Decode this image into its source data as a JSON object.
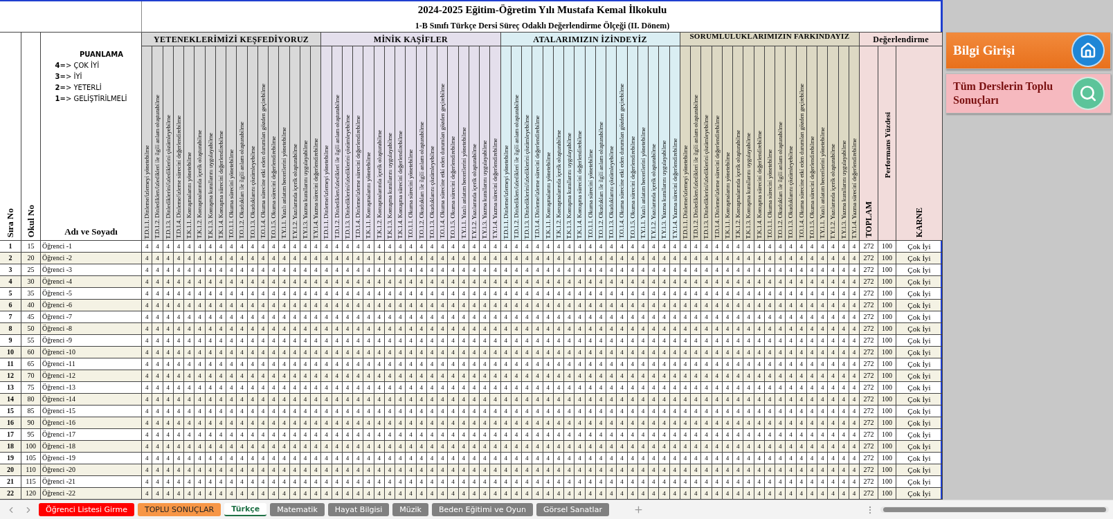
{
  "title": "2024-2025 Eğitim-Öğretim Yılı Mustafa Kemal İlkokulu",
  "subtitle": "1-B Sınıfı Türkçe Dersi Süreç Odaklı Değerlendirme Ölçeği (II. Dönem)",
  "left_headers": {
    "sira": "Sıra No",
    "okul": "Okul No",
    "name": "Adı ve Soyadı"
  },
  "legend": {
    "title": "PUANLAMA",
    "lines": [
      "**4**=> ÇOK İYİ",
      "**3**=> İYİ",
      "**2**=> YETERLİ",
      "**1**=> GELİŞTİRİLMELİ"
    ]
  },
  "sections": [
    {
      "title": "YETENEKLERİMİZİ KEŞFEDİYORUZ",
      "color": "#d9d9d9",
      "criteria": [
        "T.D.1.1. Dinleme/izlemeyi yönetebilme",
        "T.D.1.2. Dinlediklerı/izledikleri ile ilgili anlam oluşturabilme",
        "T.D.1.3. Dinlediklerini/izlediklerini çözümleyebilme",
        "T.D.1.4. Dinleme/izleme sürecini değerlendirebilme",
        "T.K.1.1. Konuşmalarını yönetebilme",
        "T.K.1.2. Konuşmalarında içerik oluşturabilme",
        "T.K.1.3. Konuşma kurallarını uygulayabilme",
        "T.K.1.4. Konuşma sürecini değerlendirebilme",
        "T.O.1.1. Okuma sürecini yönetebilme",
        "T.O.1.2. Okudukları ile ilgili anlam oluşturabilme",
        "T.O.1.3. Okuduklarını çözümleyebilme",
        "T.O.1.4. Okuma sürecine etki eden durumları gözden geçirebilme",
        "T.O.1.5. Okuma sürecini değerlendirebilme",
        "T.Y.1.1. Yazılı anlatım becerilerini yönetebilme",
        "T.Y.1.2. Yazılarında içerik oluşturabilme",
        "T.Y.1.3. Yazma kurallarını uygulayabilme",
        "T.Y.1.4. Yazma sürecini değerlendirebilme"
      ]
    },
    {
      "title": "MİNİK KAŞİFLER",
      "color": "#e4dfec",
      "criteria": [
        "T.D.1.1. Dinleme/izlemeyi yönetebilme",
        "T.D.1.2. Dinlediklerı/izledikleri ile ilgili anlam oluşturabilme",
        "T.D.1.3. Dinlediklerini/izlediklerini çözümleyebilme",
        "T.D.1.4. Dinleme/izleme sürecini değerlendirebilme",
        "T.K.1.1. Konuşmalarını yönetebilme",
        "T.K.1.2. Konuşmalarında içerik oluşturabilme",
        "T.K.1.3. Konuşma kurallarını uygulayabilme",
        "T.K.1.4. Konuşma sürecini değerlendirebilme",
        "T.O.1.1. Okuma sürecini yönetebilme",
        "T.O.1.2. Okudukları ile ilgili anlam oluşturabilme",
        "T.O.1.3. Okuduklarını çözümleyebilme",
        "T.O.1.4. Okuma sürecine etki eden durumları gözden geçirebilme",
        "T.O.1.5. Okuma sürecini değerlendirebilme",
        "T.Y.1.1. Yazılı anlatım becerilerini yönetebilme",
        "T.Y.1.2. Yazılarında içerik oluşturabilme",
        "T.Y.1.3. Yazma kurallarını uygulayabilme",
        "T.Y.1.4. Yazma sürecini değerlendirebilme"
      ]
    },
    {
      "title": "ATALARIMIZIN İZİNDEYİZ",
      "color": "#daeef3",
      "criteria": [
        "T.D.1.1. Dinleme/izlemeyi yönetebilme",
        "T.D.1.2. Dinlediklerı/izledikleri ile ilgili anlam oluşturabilme",
        "T.D.1.3. Dinlediklerini/izlediklerini çözümleyebilme",
        "T.D.1.4. Dinleme/izleme sürecini değerlendirebilme",
        "T.K.1.1. Konuşmalarını yönetebilme",
        "T.K.1.2. Konuşmalarında içerik oluşturabilme",
        "T.K.1.3. Konuşma kurallarını uygulayabilme",
        "T.K.1.4. Konuşma sürecini değerlendirebilme",
        "T.O.1.1. Okuma sürecini yönetebilme",
        "T.O.1.2. Okudukları ile ilgili anlam oluşturabilme",
        "T.O.1.3. Okuduklarını çözümleyebilme",
        "T.O.1.4. Okuma sürecine etki eden durumları gözden geçirebilme",
        "T.O.1.5. Okuma sürecini değerlendirebilme",
        "T.Y.1.1. Yazılı anlatım becerilerini yönetebilme",
        "T.Y.1.2. Yazılarında içerik oluşturabilme",
        "T.Y.1.3. Yazma kurallarını uygulayabilme",
        "T.Y.1.4. Yazma sürecini değerlendirebilme"
      ]
    },
    {
      "title": "SORUMLULUKLARIMIZIN FARKINDAYIZ",
      "color": "#ddd9c4",
      "criteria": [
        "T.D.1.1. Dinleme/izlemeyi yönetebilme",
        "T.D.1.2. Dinlediklerı/izledikleri ile ilgili anlam oluşturabilme",
        "T.D.1.3. Dinlediklerini/izlediklerini çözümleyebilme",
        "T.D.1.4. Dinleme/izleme sürecini değerlendirebilme",
        "T.K.1.1. Konuşmalarını yönetebilme",
        "T.K.1.2. Konuşmalarında içerik oluşturabilme",
        "T.K.1.3. Konuşma kurallarını uygulayabilme",
        "T.K.1.4. Konuşma sürecini değerlendirebilme",
        "T.O.1.1. Okuma sürecini yönetebilme",
        "T.O.1.2. Okudukları ile ilgili anlam oluşturabilme",
        "T.O.1.3. Okuduklarını çözümleyebilme",
        "T.O.1.4. Okuma sürecine etki eden durumları gözden geçirebilme",
        "T.O.1.5. Okuma sürecini değerlendirebilme",
        "T.Y.1.1. Yazılı anlatım becerilerini yönetebilme",
        "T.Y.1.2. Yazılarında içerik oluşturabilme",
        "T.Y.1.3. Yazma kurallarını uygulayabilme",
        "T.Y.1.4. Yazma sürecini değerlendirebilme"
      ]
    }
  ],
  "evaluation": {
    "title": "Değerlendirme",
    "color": "#f2dcdb",
    "columns": [
      "TOPLAM",
      "Performans Yüzdesi",
      "KARNE"
    ]
  },
  "rows": [
    {
      "sira": "1",
      "okul": "15",
      "name": "Öğrenci -1",
      "scores": [
        "4",
        "4",
        "4",
        "4",
        "4",
        "4",
        "4",
        "4",
        "4",
        "4",
        "4",
        "4",
        "4",
        "4",
        "4",
        "4",
        "4",
        "4",
        "4",
        "4",
        "4",
        "4",
        "4",
        "4",
        "4",
        "4",
        "4",
        "4",
        "4",
        "4",
        "4",
        "4",
        "4",
        "4",
        "4",
        "4",
        "4",
        "4",
        "4",
        "4",
        "4",
        "4",
        "4",
        "4",
        "4",
        "4",
        "4",
        "4",
        "4",
        "4",
        "4",
        "4",
        "4",
        "4",
        "4",
        "4",
        "4",
        "4",
        "4",
        "4",
        "4",
        "4",
        "4",
        "4",
        "4",
        "4",
        "4",
        "4"
      ],
      "toplam": "272",
      "yuzde": "100",
      "karne": "Çok İyi"
    },
    {
      "sira": "2",
      "okul": "20",
      "name": "Öğrenci -2",
      "scores": [
        "4",
        "4",
        "4",
        "4",
        "4",
        "4",
        "4",
        "4",
        "4",
        "4",
        "4",
        "4",
        "4",
        "4",
        "4",
        "4",
        "4",
        "4",
        "4",
        "4",
        "4",
        "4",
        "4",
        "4",
        "4",
        "4",
        "4",
        "4",
        "4",
        "4",
        "4",
        "4",
        "4",
        "4",
        "4",
        "4",
        "4",
        "4",
        "4",
        "4",
        "4",
        "4",
        "4",
        "4",
        "4",
        "4",
        "4",
        "4",
        "4",
        "4",
        "4",
        "4",
        "4",
        "4",
        "4",
        "4",
        "4",
        "4",
        "4",
        "4",
        "4",
        "4",
        "4",
        "4",
        "4",
        "4",
        "4",
        "4"
      ],
      "toplam": "272",
      "yuzde": "100",
      "karne": "Çok İyi"
    },
    {
      "sira": "3",
      "okul": "25",
      "name": "Öğrenci -3",
      "scores": [
        "4",
        "4",
        "4",
        "4",
        "4",
        "4",
        "4",
        "4",
        "4",
        "4",
        "4",
        "4",
        "4",
        "4",
        "4",
        "4",
        "4",
        "4",
        "4",
        "4",
        "4",
        "4",
        "4",
        "4",
        "4",
        "4",
        "4",
        "4",
        "4",
        "4",
        "4",
        "4",
        "4",
        "4",
        "4",
        "4",
        "4",
        "4",
        "4",
        "4",
        "4",
        "4",
        "4",
        "4",
        "4",
        "4",
        "4",
        "4",
        "4",
        "4",
        "4",
        "4",
        "4",
        "4",
        "4",
        "4",
        "4",
        "4",
        "4",
        "4",
        "4",
        "4",
        "4",
        "4",
        "4",
        "4",
        "4",
        "4"
      ],
      "toplam": "272",
      "yuzde": "100",
      "karne": "Çok İyi"
    },
    {
      "sira": "4",
      "okul": "30",
      "name": "Öğrenci -4",
      "scores": [
        "4",
        "4",
        "4",
        "4",
        "4",
        "4",
        "4",
        "4",
        "4",
        "4",
        "4",
        "4",
        "4",
        "4",
        "4",
        "4",
        "4",
        "4",
        "4",
        "4",
        "4",
        "4",
        "4",
        "4",
        "4",
        "4",
        "4",
        "4",
        "4",
        "4",
        "4",
        "4",
        "4",
        "4",
        "4",
        "4",
        "4",
        "4",
        "4",
        "4",
        "4",
        "4",
        "4",
        "4",
        "4",
        "4",
        "4",
        "4",
        "4",
        "4",
        "4",
        "4",
        "4",
        "4",
        "4",
        "4",
        "4",
        "4",
        "4",
        "4",
        "4",
        "4",
        "4",
        "4",
        "4",
        "4",
        "4",
        "4"
      ],
      "toplam": "272",
      "yuzde": "100",
      "karne": "Çok İyi"
    },
    {
      "sira": "5",
      "okul": "35",
      "name": "Öğrenci -5",
      "scores": [
        "4",
        "4",
        "4",
        "4",
        "4",
        "4",
        "4",
        "4",
        "4",
        "4",
        "4",
        "4",
        "4",
        "4",
        "4",
        "4",
        "4",
        "4",
        "4",
        "4",
        "4",
        "4",
        "4",
        "4",
        "4",
        "4",
        "4",
        "4",
        "4",
        "4",
        "4",
        "4",
        "4",
        "4",
        "4",
        "4",
        "4",
        "4",
        "4",
        "4",
        "4",
        "4",
        "4",
        "4",
        "4",
        "4",
        "4",
        "4",
        "4",
        "4",
        "4",
        "4",
        "4",
        "4",
        "4",
        "4",
        "4",
        "4",
        "4",
        "4",
        "4",
        "4",
        "4",
        "4",
        "4",
        "4",
        "4",
        "4"
      ],
      "toplam": "272",
      "yuzde": "100",
      "karne": "Çok İyi"
    },
    {
      "sira": "6",
      "okul": "40",
      "name": "Öğrenci -6",
      "scores": [
        "4",
        "4",
        "4",
        "4",
        "4",
        "4",
        "4",
        "4",
        "4",
        "4",
        "4",
        "4",
        "4",
        "4",
        "4",
        "4",
        "4",
        "4",
        "4",
        "4",
        "4",
        "4",
        "4",
        "4",
        "4",
        "4",
        "4",
        "4",
        "4",
        "4",
        "4",
        "4",
        "4",
        "4",
        "4",
        "4",
        "4",
        "4",
        "4",
        "4",
        "4",
        "4",
        "4",
        "4",
        "4",
        "4",
        "4",
        "4",
        "4",
        "4",
        "4",
        "4",
        "4",
        "4",
        "4",
        "4",
        "4",
        "4",
        "4",
        "4",
        "4",
        "4",
        "4",
        "4",
        "4",
        "4",
        "4",
        "4"
      ],
      "toplam": "272",
      "yuzde": "100",
      "karne": "Çok İyi"
    },
    {
      "sira": "7",
      "okul": "45",
      "name": "Öğrenci -7",
      "scores": [
        "4",
        "4",
        "4",
        "4",
        "4",
        "4",
        "4",
        "4",
        "4",
        "4",
        "4",
        "4",
        "4",
        "4",
        "4",
        "4",
        "4",
        "4",
        "4",
        "4",
        "4",
        "4",
        "4",
        "4",
        "4",
        "4",
        "4",
        "4",
        "4",
        "4",
        "4",
        "4",
        "4",
        "4",
        "4",
        "4",
        "4",
        "4",
        "4",
        "4",
        "4",
        "4",
        "4",
        "4",
        "4",
        "4",
        "4",
        "4",
        "4",
        "4",
        "4",
        "4",
        "4",
        "4",
        "4",
        "4",
        "4",
        "4",
        "4",
        "4",
        "4",
        "4",
        "4",
        "4",
        "4",
        "4",
        "4",
        "4"
      ],
      "toplam": "272",
      "yuzde": "100",
      "karne": "Çok İyi"
    },
    {
      "sira": "8",
      "okul": "50",
      "name": "Öğrenci -8",
      "scores": [
        "4",
        "4",
        "4",
        "4",
        "4",
        "4",
        "4",
        "4",
        "4",
        "4",
        "4",
        "4",
        "4",
        "4",
        "4",
        "4",
        "4",
        "4",
        "4",
        "4",
        "4",
        "4",
        "4",
        "4",
        "4",
        "4",
        "4",
        "4",
        "4",
        "4",
        "4",
        "4",
        "4",
        "4",
        "4",
        "4",
        "4",
        "4",
        "4",
        "4",
        "4",
        "4",
        "4",
        "4",
        "4",
        "4",
        "4",
        "4",
        "4",
        "4",
        "4",
        "4",
        "4",
        "4",
        "4",
        "4",
        "4",
        "4",
        "4",
        "4",
        "4",
        "4",
        "4",
        "4",
        "4",
        "4",
        "4",
        "4"
      ],
      "toplam": "272",
      "yuzde": "100",
      "karne": "Çok İyi"
    },
    {
      "sira": "9",
      "okul": "55",
      "name": "Öğrenci -9",
      "scores": [
        "4",
        "4",
        "4",
        "4",
        "4",
        "4",
        "4",
        "4",
        "4",
        "4",
        "4",
        "4",
        "4",
        "4",
        "4",
        "4",
        "4",
        "4",
        "4",
        "4",
        "4",
        "4",
        "4",
        "4",
        "4",
        "4",
        "4",
        "4",
        "4",
        "4",
        "4",
        "4",
        "4",
        "4",
        "4",
        "4",
        "4",
        "4",
        "4",
        "4",
        "4",
        "4",
        "4",
        "4",
        "4",
        "4",
        "4",
        "4",
        "4",
        "4",
        "4",
        "4",
        "4",
        "4",
        "4",
        "4",
        "4",
        "4",
        "4",
        "4",
        "4",
        "4",
        "4",
        "4",
        "4",
        "4",
        "4",
        "4"
      ],
      "toplam": "272",
      "yuzde": "100",
      "karne": "Çok İyi"
    },
    {
      "sira": "10",
      "okul": "60",
      "name": "Öğrenci -10",
      "scores": [
        "4",
        "4",
        "4",
        "4",
        "4",
        "4",
        "4",
        "4",
        "4",
        "4",
        "4",
        "4",
        "4",
        "4",
        "4",
        "4",
        "4",
        "4",
        "4",
        "4",
        "4",
        "4",
        "4",
        "4",
        "4",
        "4",
        "4",
        "4",
        "4",
        "4",
        "4",
        "4",
        "4",
        "4",
        "4",
        "4",
        "4",
        "4",
        "4",
        "4",
        "4",
        "4",
        "4",
        "4",
        "4",
        "4",
        "4",
        "4",
        "4",
        "4",
        "4",
        "4",
        "4",
        "4",
        "4",
        "4",
        "4",
        "4",
        "4",
        "4",
        "4",
        "4",
        "4",
        "4",
        "4",
        "4",
        "4",
        "4"
      ],
      "toplam": "272",
      "yuzde": "100",
      "karne": "Çok İyi"
    },
    {
      "sira": "11",
      "okul": "65",
      "name": "Öğrenci -11",
      "scores": [
        "4",
        "4",
        "4",
        "4",
        "4",
        "4",
        "4",
        "4",
        "4",
        "4",
        "4",
        "4",
        "4",
        "4",
        "4",
        "4",
        "4",
        "4",
        "4",
        "4",
        "4",
        "4",
        "4",
        "4",
        "4",
        "4",
        "4",
        "4",
        "4",
        "4",
        "4",
        "4",
        "4",
        "4",
        "4",
        "4",
        "4",
        "4",
        "4",
        "4",
        "4",
        "4",
        "4",
        "4",
        "4",
        "4",
        "4",
        "4",
        "4",
        "4",
        "4",
        "4",
        "4",
        "4",
        "4",
        "4",
        "4",
        "4",
        "4",
        "4",
        "4",
        "4",
        "4",
        "4",
        "4",
        "4",
        "4",
        "4"
      ],
      "toplam": "272",
      "yuzde": "100",
      "karne": "Çok İyi"
    },
    {
      "sira": "12",
      "okul": "70",
      "name": "Öğrenci -12",
      "scores": [
        "4",
        "4",
        "4",
        "4",
        "4",
        "4",
        "4",
        "4",
        "4",
        "4",
        "4",
        "4",
        "4",
        "4",
        "4",
        "4",
        "4",
        "4",
        "4",
        "4",
        "4",
        "4",
        "4",
        "4",
        "4",
        "4",
        "4",
        "4",
        "4",
        "4",
        "4",
        "4",
        "4",
        "4",
        "4",
        "4",
        "4",
        "4",
        "4",
        "4",
        "4",
        "4",
        "4",
        "4",
        "4",
        "4",
        "4",
        "4",
        "4",
        "4",
        "4",
        "4",
        "4",
        "4",
        "4",
        "4",
        "4",
        "4",
        "4",
        "4",
        "4",
        "4",
        "4",
        "4",
        "4",
        "4",
        "4",
        "4"
      ],
      "toplam": "272",
      "yuzde": "100",
      "karne": "Çok İyi"
    },
    {
      "sira": "13",
      "okul": "75",
      "name": "Öğrenci -13",
      "scores": [
        "4",
        "4",
        "4",
        "4",
        "4",
        "4",
        "4",
        "4",
        "4",
        "4",
        "4",
        "4",
        "4",
        "4",
        "4",
        "4",
        "4",
        "4",
        "4",
        "4",
        "4",
        "4",
        "4",
        "4",
        "4",
        "4",
        "4",
        "4",
        "4",
        "4",
        "4",
        "4",
        "4",
        "4",
        "4",
        "4",
        "4",
        "4",
        "4",
        "4",
        "4",
        "4",
        "4",
        "4",
        "4",
        "4",
        "4",
        "4",
        "4",
        "4",
        "4",
        "4",
        "4",
        "4",
        "4",
        "4",
        "4",
        "4",
        "4",
        "4",
        "4",
        "4",
        "4",
        "4",
        "4",
        "4",
        "4",
        "4"
      ],
      "toplam": "272",
      "yuzde": "100",
      "karne": "Çok İyi"
    },
    {
      "sira": "14",
      "okul": "80",
      "name": "Öğrenci -14",
      "scores": [
        "4",
        "4",
        "4",
        "4",
        "4",
        "4",
        "4",
        "4",
        "4",
        "4",
        "4",
        "4",
        "4",
        "4",
        "4",
        "4",
        "4",
        "4",
        "4",
        "4",
        "4",
        "4",
        "4",
        "4",
        "4",
        "4",
        "4",
        "4",
        "4",
        "4",
        "4",
        "4",
        "4",
        "4",
        "4",
        "4",
        "4",
        "4",
        "4",
        "4",
        "4",
        "4",
        "4",
        "4",
        "4",
        "4",
        "4",
        "4",
        "4",
        "4",
        "4",
        "4",
        "4",
        "4",
        "4",
        "4",
        "4",
        "4",
        "4",
        "4",
        "4",
        "4",
        "4",
        "4",
        "4",
        "4",
        "4",
        "4"
      ],
      "toplam": "272",
      "yuzde": "100",
      "karne": "Çok İyi"
    },
    {
      "sira": "15",
      "okul": "85",
      "name": "Öğrenci -15",
      "scores": [
        "4",
        "4",
        "4",
        "4",
        "4",
        "4",
        "4",
        "4",
        "4",
        "4",
        "4",
        "4",
        "4",
        "4",
        "4",
        "4",
        "4",
        "4",
        "4",
        "4",
        "4",
        "4",
        "4",
        "4",
        "4",
        "4",
        "4",
        "4",
        "4",
        "4",
        "4",
        "4",
        "4",
        "4",
        "4",
        "4",
        "4",
        "4",
        "4",
        "4",
        "4",
        "4",
        "4",
        "4",
        "4",
        "4",
        "4",
        "4",
        "4",
        "4",
        "4",
        "4",
        "4",
        "4",
        "4",
        "4",
        "4",
        "4",
        "4",
        "4",
        "4",
        "4",
        "4",
        "4",
        "4",
        "4",
        "4",
        "4"
      ],
      "toplam": "272",
      "yuzde": "100",
      "karne": "Çok İyi"
    },
    {
      "sira": "16",
      "okul": "90",
      "name": "Öğrenci -16",
      "scores": [
        "4",
        "4",
        "4",
        "4",
        "4",
        "4",
        "4",
        "4",
        "4",
        "4",
        "4",
        "4",
        "4",
        "4",
        "4",
        "4",
        "4",
        "4",
        "4",
        "4",
        "4",
        "4",
        "4",
        "4",
        "4",
        "4",
        "4",
        "4",
        "4",
        "4",
        "4",
        "4",
        "4",
        "4",
        "4",
        "4",
        "4",
        "4",
        "4",
        "4",
        "4",
        "4",
        "4",
        "4",
        "4",
        "4",
        "4",
        "4",
        "4",
        "4",
        "4",
        "4",
        "4",
        "4",
        "4",
        "4",
        "4",
        "4",
        "4",
        "4",
        "4",
        "4",
        "4",
        "4",
        "4",
        "4",
        "4",
        "4"
      ],
      "toplam": "272",
      "yuzde": "100",
      "karne": "Çok İyi"
    },
    {
      "sira": "17",
      "okul": "95",
      "name": "Öğrenci -17",
      "scores": [
        "4",
        "4",
        "4",
        "4",
        "4",
        "4",
        "4",
        "4",
        "4",
        "4",
        "4",
        "4",
        "4",
        "4",
        "4",
        "4",
        "4",
        "4",
        "4",
        "4",
        "4",
        "4",
        "4",
        "4",
        "4",
        "4",
        "4",
        "4",
        "4",
        "4",
        "4",
        "4",
        "4",
        "4",
        "4",
        "4",
        "4",
        "4",
        "4",
        "4",
        "4",
        "4",
        "4",
        "4",
        "4",
        "4",
        "4",
        "4",
        "4",
        "4",
        "4",
        "4",
        "4",
        "4",
        "4",
        "4",
        "4",
        "4",
        "4",
        "4",
        "4",
        "4",
        "4",
        "4",
        "4",
        "4",
        "4",
        "4"
      ],
      "toplam": "272",
      "yuzde": "100",
      "karne": "Çok İyi"
    },
    {
      "sira": "18",
      "okul": "100",
      "name": "Öğrenci -18",
      "scores": [
        "4",
        "4",
        "4",
        "4",
        "4",
        "4",
        "4",
        "4",
        "4",
        "4",
        "4",
        "4",
        "4",
        "4",
        "4",
        "4",
        "4",
        "4",
        "4",
        "4",
        "4",
        "4",
        "4",
        "4",
        "4",
        "4",
        "4",
        "4",
        "4",
        "4",
        "4",
        "4",
        "4",
        "4",
        "4",
        "4",
        "4",
        "4",
        "4",
        "4",
        "4",
        "4",
        "4",
        "4",
        "4",
        "4",
        "4",
        "4",
        "4",
        "4",
        "4",
        "4",
        "4",
        "4",
        "4",
        "4",
        "4",
        "4",
        "4",
        "4",
        "4",
        "4",
        "4",
        "4",
        "4",
        "4",
        "4",
        "4"
      ],
      "toplam": "272",
      "yuzde": "100",
      "karne": "Çok İyi"
    },
    {
      "sira": "19",
      "okul": "105",
      "name": "Öğrenci -19",
      "scores": [
        "4",
        "4",
        "4",
        "4",
        "4",
        "4",
        "4",
        "4",
        "4",
        "4",
        "4",
        "4",
        "4",
        "4",
        "4",
        "4",
        "4",
        "4",
        "4",
        "4",
        "4",
        "4",
        "4",
        "4",
        "4",
        "4",
        "4",
        "4",
        "4",
        "4",
        "4",
        "4",
        "4",
        "4",
        "4",
        "4",
        "4",
        "4",
        "4",
        "4",
        "4",
        "4",
        "4",
        "4",
        "4",
        "4",
        "4",
        "4",
        "4",
        "4",
        "4",
        "4",
        "4",
        "4",
        "4",
        "4",
        "4",
        "4",
        "4",
        "4",
        "4",
        "4",
        "4",
        "4",
        "4",
        "4",
        "4",
        "4"
      ],
      "toplam": "272",
      "yuzde": "100",
      "karne": "Çok İyi"
    },
    {
      "sira": "20",
      "okul": "110",
      "name": "Öğrenci -20",
      "scores": [
        "4",
        "4",
        "4",
        "4",
        "4",
        "4",
        "4",
        "4",
        "4",
        "4",
        "4",
        "4",
        "4",
        "4",
        "4",
        "4",
        "4",
        "4",
        "4",
        "4",
        "4",
        "4",
        "4",
        "4",
        "4",
        "4",
        "4",
        "4",
        "4",
        "4",
        "4",
        "4",
        "4",
        "4",
        "4",
        "4",
        "4",
        "4",
        "4",
        "4",
        "4",
        "4",
        "4",
        "4",
        "4",
        "4",
        "4",
        "4",
        "4",
        "4",
        "4",
        "4",
        "4",
        "4",
        "4",
        "4",
        "4",
        "4",
        "4",
        "4",
        "4",
        "4",
        "4",
        "4",
        "4",
        "4",
        "4",
        "4"
      ],
      "toplam": "272",
      "yuzde": "100",
      "karne": "Çok İyi"
    },
    {
      "sira": "21",
      "okul": "115",
      "name": "Öğrenci -21",
      "scores": [
        "4",
        "4",
        "4",
        "4",
        "4",
        "4",
        "4",
        "4",
        "4",
        "4",
        "4",
        "4",
        "4",
        "4",
        "4",
        "4",
        "4",
        "4",
        "4",
        "4",
        "4",
        "4",
        "4",
        "4",
        "4",
        "4",
        "4",
        "4",
        "4",
        "4",
        "4",
        "4",
        "4",
        "4",
        "4",
        "4",
        "4",
        "4",
        "4",
        "4",
        "4",
        "4",
        "4",
        "4",
        "4",
        "4",
        "4",
        "4",
        "4",
        "4",
        "4",
        "4",
        "4",
        "4",
        "4",
        "4",
        "4",
        "4",
        "4",
        "4",
        "4",
        "4",
        "4",
        "4",
        "4",
        "4",
        "4",
        "4"
      ],
      "toplam": "272",
      "yuzde": "100",
      "karne": "Çok İyi"
    },
    {
      "sira": "22",
      "okul": "120",
      "name": "Öğrenci -22",
      "scores": [
        "4",
        "4",
        "4",
        "4",
        "4",
        "4",
        "4",
        "4",
        "4",
        "4",
        "4",
        "4",
        "4",
        "4",
        "4",
        "4",
        "4",
        "4",
        "4",
        "4",
        "4",
        "4",
        "4",
        "4",
        "4",
        "4",
        "4",
        "4",
        "4",
        "4",
        "4",
        "4",
        "4",
        "4",
        "4",
        "4",
        "4",
        "4",
        "4",
        "4",
        "4",
        "4",
        "4",
        "4",
        "4",
        "4",
        "4",
        "4",
        "4",
        "4",
        "4",
        "4",
        "4",
        "4",
        "4",
        "4",
        "4",
        "4",
        "4",
        "4",
        "4",
        "4",
        "4",
        "4",
        "4",
        "4",
        "4",
        "4"
      ],
      "toplam": "272",
      "yuzde": "100",
      "karne": "Çok İyi"
    }
  ],
  "side_buttons": [
    {
      "label": "Bilgi Girişi",
      "kind": "home"
    },
    {
      "label": "Tüm Derslerin Toplu Sonuçları",
      "kind": "search"
    }
  ],
  "sheet_tabs": [
    {
      "label": "Öğrenci Listesi Girme",
      "color": "#ff0000",
      "selected": false
    },
    {
      "label": "TOPLU SONUÇLAR",
      "color": "#f79646",
      "selected": false
    },
    {
      "label": "Türkçe",
      "color": "#ffffff",
      "selected": true
    },
    {
      "label": "Matematik",
      "color": "#808080",
      "selected": false
    },
    {
      "label": "Hayat Bilgisi",
      "color": "#808080",
      "selected": false
    },
    {
      "label": "Müzik",
      "color": "#808080",
      "selected": false
    },
    {
      "label": "Beden Eğitimi ve Oyun",
      "color": "#808080",
      "selected": false
    },
    {
      "label": "Görsel Sanatlar",
      "color": "#808080",
      "selected": false
    }
  ]
}
